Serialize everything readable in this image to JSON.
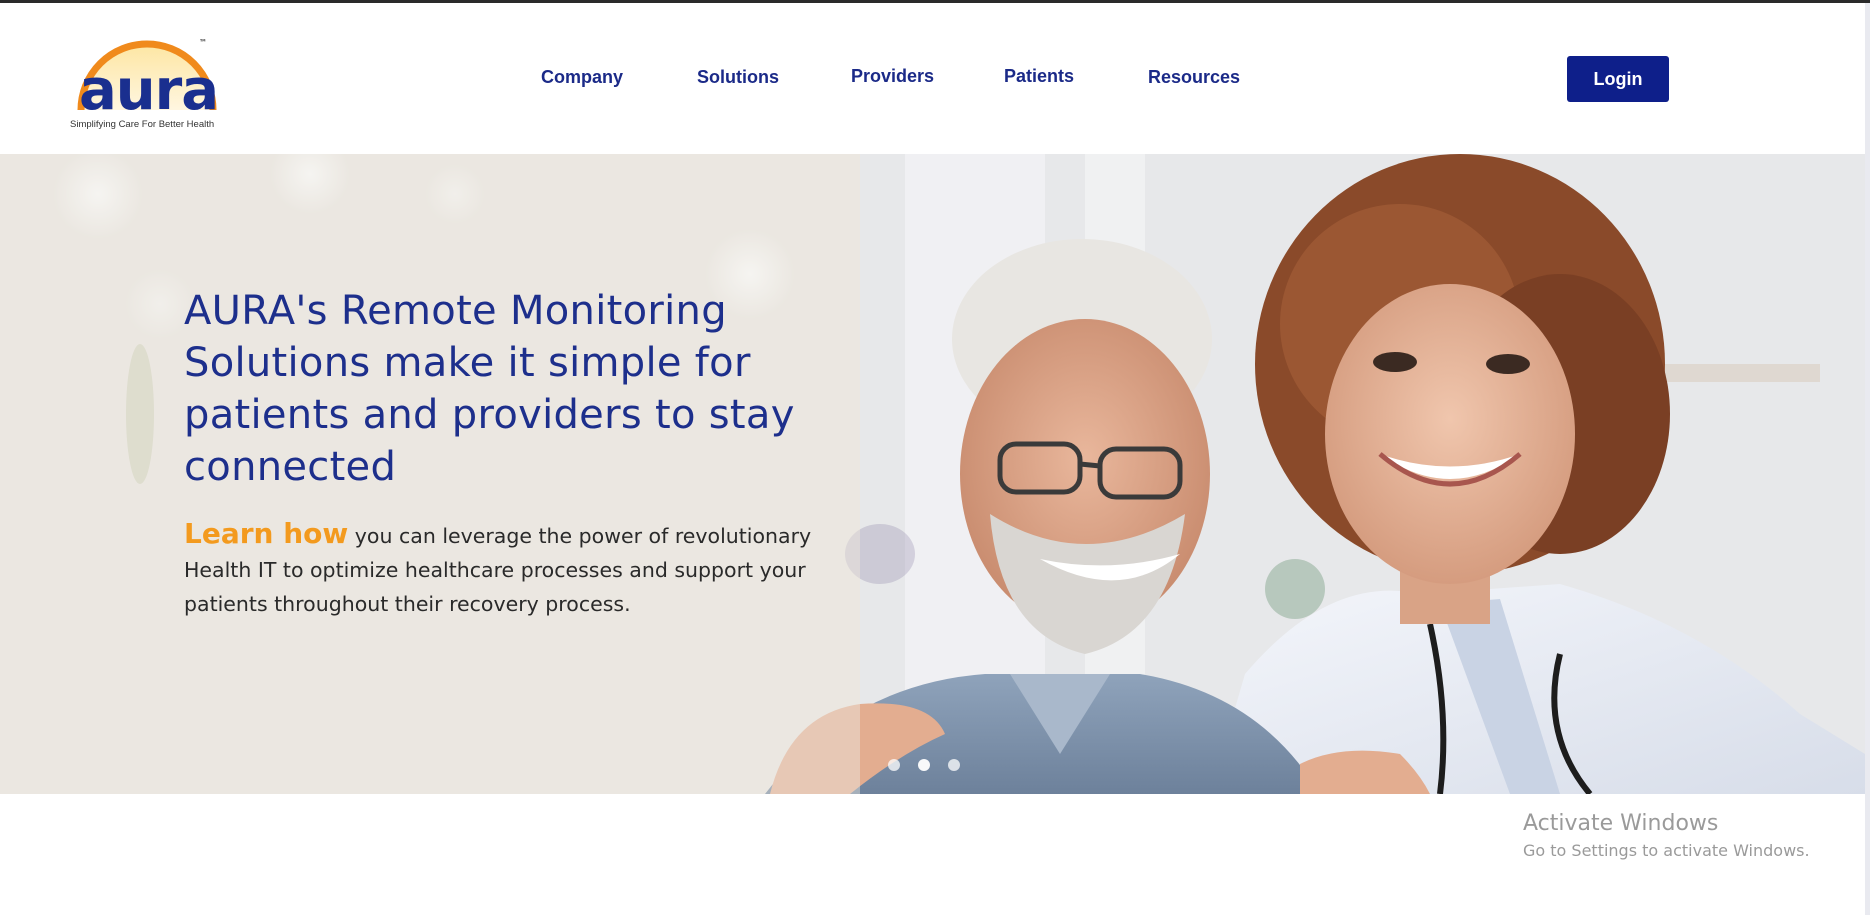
{
  "header": {
    "logo": {
      "word": "aura",
      "trademark": "™",
      "tagline": "Simplifying Care For Better Health"
    },
    "nav": [
      {
        "label": "Company"
      },
      {
        "label": "Solutions"
      },
      {
        "label": "Providers"
      },
      {
        "label": "Patients"
      },
      {
        "label": "Resources"
      }
    ],
    "login_label": "Login"
  },
  "hero": {
    "title": "AURA's Remote Monitoring Solutions make it simple for patients and providers to stay connected",
    "learn_how": "Learn how",
    "body": "you can leverage the power of revolutionary Health IT to optimize healthcare processes and support your patients throughout their recovery process.",
    "carousel_slide_count": 3
  },
  "watermark": {
    "title": "Activate Windows",
    "subtitle": "Go to Settings to activate Windows."
  },
  "colors": {
    "brand_navy": "#0e1f8a",
    "nav_text": "#1b2a88",
    "accent_orange": "#f39a1e",
    "logo_orange": "#f08a1c"
  }
}
